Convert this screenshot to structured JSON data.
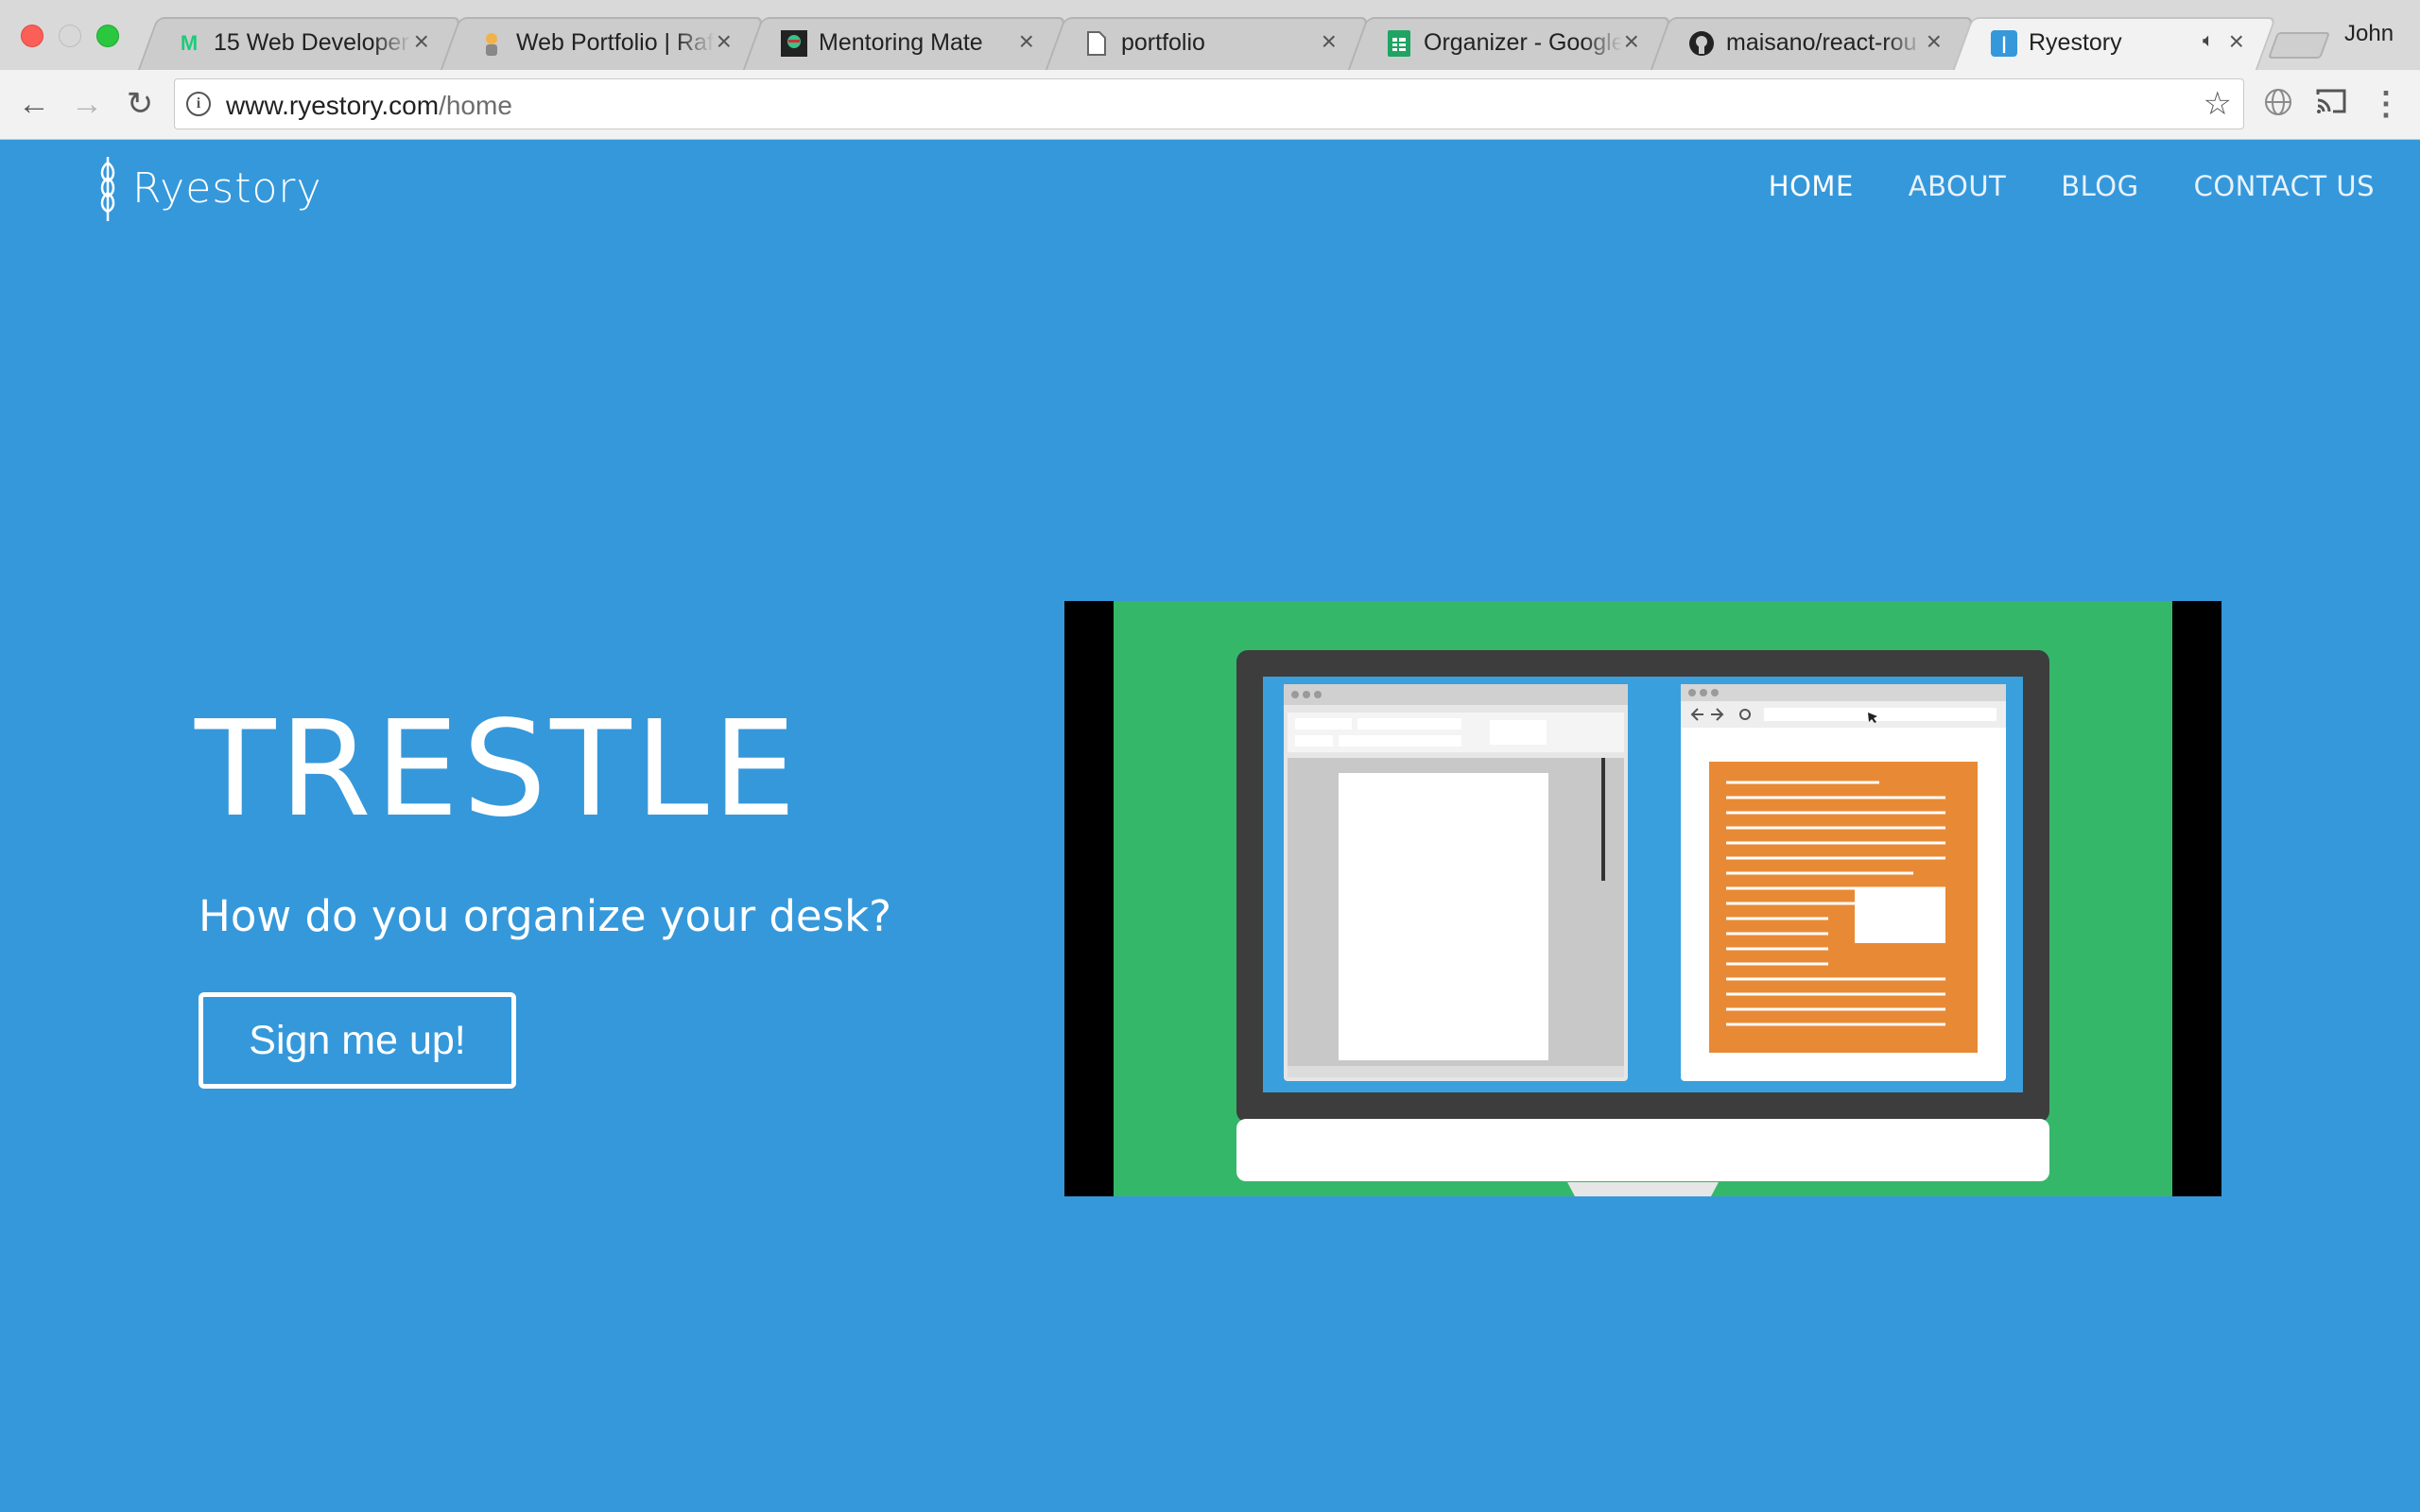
{
  "browser": {
    "tabs": [
      {
        "title": "15 Web Developer",
        "favicon": "medium-icon",
        "active": false
      },
      {
        "title": "Web Portfolio | Raf",
        "favicon": "avatar-icon",
        "active": false
      },
      {
        "title": "Mentoring Mate",
        "favicon": "mentoring-icon",
        "active": false
      },
      {
        "title": "portfolio",
        "favicon": "document-icon",
        "active": false
      },
      {
        "title": "Organizer - Google",
        "favicon": "sheets-icon",
        "active": false
      },
      {
        "title": "maisano/react-rou",
        "favicon": "github-icon",
        "active": false
      },
      {
        "title": "Ryestory",
        "favicon": "ryestory-icon",
        "active": true
      }
    ],
    "profile_name": "John",
    "url_host": "www.ryestory.com",
    "url_path": "/home"
  },
  "site": {
    "brand": "Ryestory",
    "nav": [
      {
        "label": "HOME",
        "active": true
      },
      {
        "label": "ABOUT",
        "active": false
      },
      {
        "label": "BLOG",
        "active": false
      },
      {
        "label": "CONTACT US",
        "active": false
      }
    ],
    "hero": {
      "title": "TRESTLE",
      "subtitle": "How do you organize your desk?",
      "cta_label": "Sign me up!"
    },
    "colors": {
      "page_bg": "#3598db",
      "video_bg": "#35b76a",
      "monitor": "#3d3d3d",
      "screen": "#3a9fdd",
      "doc_orange": "#e88a35"
    }
  }
}
